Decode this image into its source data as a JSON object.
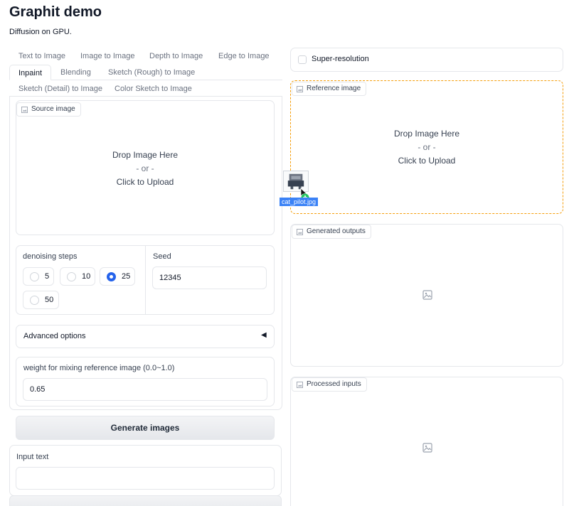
{
  "app": {
    "title": "Graphit demo",
    "subtitle": "Diffusion on GPU."
  },
  "tabs": [
    {
      "label": "Text to Image",
      "active": false
    },
    {
      "label": "Image to Image",
      "active": false
    },
    {
      "label": "Depth to Image",
      "active": false
    },
    {
      "label": "Edge to Image",
      "active": false
    },
    {
      "label": "Inpaint",
      "active": true
    },
    {
      "label": "Blending",
      "active": false
    },
    {
      "label": "Sketch (Rough) to Image",
      "active": false
    },
    {
      "label": "Sketch (Detail) to Image",
      "active": false
    },
    {
      "label": "Color Sketch to Image",
      "active": false
    }
  ],
  "source_image": {
    "label": "Source image",
    "drop_text": "Drop Image Here",
    "or_text": "- or -",
    "click_text": "Click to Upload"
  },
  "denoising": {
    "label": "denoising steps",
    "options": [
      "5",
      "10",
      "25",
      "50"
    ],
    "selected": "25"
  },
  "seed": {
    "label": "Seed",
    "value": "12345"
  },
  "advanced": {
    "label": "Advanced options",
    "arrow": "◀"
  },
  "weight": {
    "label": "weight for mixing reference image (0.0~1.0)",
    "value": "0.65"
  },
  "generate_button": "Generate images",
  "input_text": {
    "label": "Input text",
    "value": ""
  },
  "super_resolution": {
    "label": "Super-resolution",
    "checked": false
  },
  "reference_image": {
    "label": "Reference image",
    "drop_text": "Drop Image Here",
    "or_text": "- or -",
    "click_text": "Click to Upload"
  },
  "dragging_file": {
    "name": "cat_pilot.jpg"
  },
  "generated_outputs": {
    "label": "Generated outputs"
  },
  "processed_inputs": {
    "label": "Processed inputs"
  },
  "colors": {
    "accent": "#2563eb",
    "drop_highlight": "#f59e0b",
    "border": "#e5e7eb"
  },
  "icons": {
    "image_chip": "image-icon",
    "empty_image": "image-placeholder-icon"
  }
}
